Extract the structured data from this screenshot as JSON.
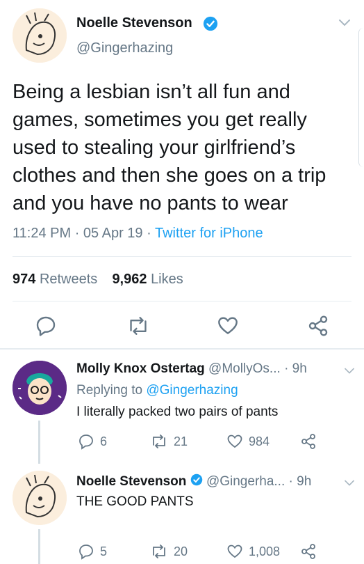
{
  "main_tweet": {
    "author_name": "Noelle Stevenson",
    "handle": "@Gingerhazing",
    "text": "Being a lesbian isn’t all fun and games, sometimes you get really used to stealing your girlfriend’s clothes and then she goes on a trip and you have no pants to wear",
    "time": "11:24 PM",
    "date": "05 Apr 19",
    "source": "Twitter for iPhone",
    "sep": "·",
    "retweets_count": "974",
    "retweets_label": "Retweets",
    "likes_count": "9,962",
    "likes_label": "Likes"
  },
  "reply_1": {
    "author_name": "Molly Knox Ostertag",
    "handle": "@MollyOs...",
    "time": "· 9h",
    "replying_to_label": "Replying to",
    "replying_to_handle": "@Gingerhazing",
    "text": "I literally packed two pairs of pants",
    "reply_count": "6",
    "retweet_count": "21",
    "like_count": "984"
  },
  "reply_2": {
    "author_name": "Noelle Stevenson",
    "handle": "@Gingerha...",
    "time": "· 9h",
    "text": "THE GOOD PANTS",
    "reply_count": "5",
    "retweet_count": "20",
    "like_count": "1,008"
  },
  "colors": {
    "accent": "#1da1f2",
    "muted": "#657786",
    "text": "#14171a",
    "divider": "#e6ecf0"
  },
  "icons": [
    "verified-badge-icon",
    "chevron-down-icon",
    "reply-icon",
    "retweet-icon",
    "like-icon",
    "share-icon"
  ]
}
